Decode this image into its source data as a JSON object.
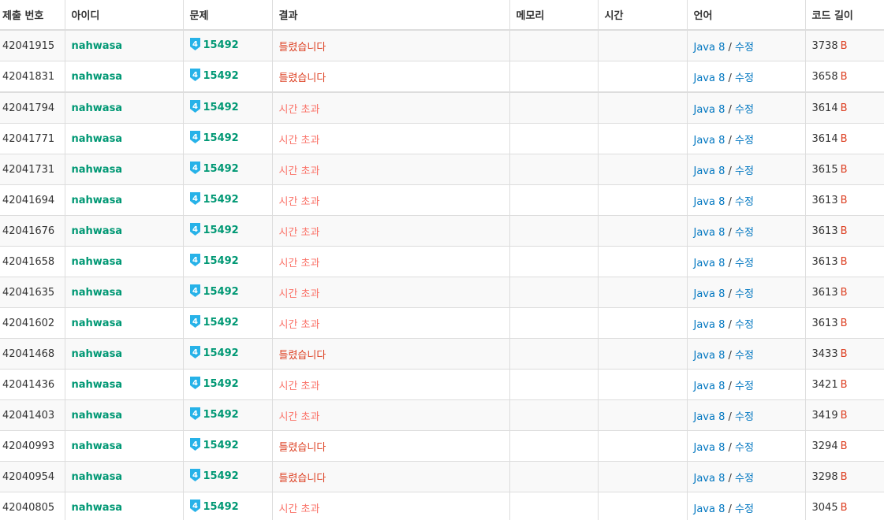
{
  "headers": {
    "id": "제출 번호",
    "user": "아이디",
    "problem": "문제",
    "result": "결과",
    "memory": "메모리",
    "time": "시간",
    "language": "언어",
    "code_length": "코드 길이"
  },
  "tier_icon": {
    "name": "silver-4-tier-icon",
    "label": "4",
    "color": "#27b2e8"
  },
  "edit_label": "수정",
  "slash": "/",
  "byte_unit": "B",
  "rows": [
    {
      "id": "42041915",
      "user": "nahwasa",
      "problem": "15492",
      "result": "틀렸습니다",
      "result_type": "wa",
      "memory": "",
      "time": "",
      "language": "Java 8",
      "length": "3738"
    },
    {
      "id": "42041831",
      "user": "nahwasa",
      "problem": "15492",
      "result": "틀렸습니다",
      "result_type": "wa",
      "memory": "",
      "time": "",
      "language": "Java 8",
      "length": "3658"
    },
    {
      "id": "42041794",
      "user": "nahwasa",
      "problem": "15492",
      "result": "시간 초과",
      "result_type": "tle",
      "memory": "",
      "time": "",
      "language": "Java 8",
      "length": "3614"
    },
    {
      "id": "42041771",
      "user": "nahwasa",
      "problem": "15492",
      "result": "시간 초과",
      "result_type": "tle",
      "memory": "",
      "time": "",
      "language": "Java 8",
      "length": "3614"
    },
    {
      "id": "42041731",
      "user": "nahwasa",
      "problem": "15492",
      "result": "시간 초과",
      "result_type": "tle",
      "memory": "",
      "time": "",
      "language": "Java 8",
      "length": "3615"
    },
    {
      "id": "42041694",
      "user": "nahwasa",
      "problem": "15492",
      "result": "시간 초과",
      "result_type": "tle",
      "memory": "",
      "time": "",
      "language": "Java 8",
      "length": "3613"
    },
    {
      "id": "42041676",
      "user": "nahwasa",
      "problem": "15492",
      "result": "시간 초과",
      "result_type": "tle",
      "memory": "",
      "time": "",
      "language": "Java 8",
      "length": "3613"
    },
    {
      "id": "42041658",
      "user": "nahwasa",
      "problem": "15492",
      "result": "시간 초과",
      "result_type": "tle",
      "memory": "",
      "time": "",
      "language": "Java 8",
      "length": "3613"
    },
    {
      "id": "42041635",
      "user": "nahwasa",
      "problem": "15492",
      "result": "시간 초과",
      "result_type": "tle",
      "memory": "",
      "time": "",
      "language": "Java 8",
      "length": "3613"
    },
    {
      "id": "42041602",
      "user": "nahwasa",
      "problem": "15492",
      "result": "시간 초과",
      "result_type": "tle",
      "memory": "",
      "time": "",
      "language": "Java 8",
      "length": "3613"
    },
    {
      "id": "42041468",
      "user": "nahwasa",
      "problem": "15492",
      "result": "틀렸습니다",
      "result_type": "wa",
      "memory": "",
      "time": "",
      "language": "Java 8",
      "length": "3433"
    },
    {
      "id": "42041436",
      "user": "nahwasa",
      "problem": "15492",
      "result": "시간 초과",
      "result_type": "tle",
      "memory": "",
      "time": "",
      "language": "Java 8",
      "length": "3421"
    },
    {
      "id": "42041403",
      "user": "nahwasa",
      "problem": "15492",
      "result": "시간 초과",
      "result_type": "tle",
      "memory": "",
      "time": "",
      "language": "Java 8",
      "length": "3419"
    },
    {
      "id": "42040993",
      "user": "nahwasa",
      "problem": "15492",
      "result": "틀렸습니다",
      "result_type": "wa",
      "memory": "",
      "time": "",
      "language": "Java 8",
      "length": "3294"
    },
    {
      "id": "42040954",
      "user": "nahwasa",
      "problem": "15492",
      "result": "틀렸습니다",
      "result_type": "wa",
      "memory": "",
      "time": "",
      "language": "Java 8",
      "length": "3298"
    },
    {
      "id": "42040805",
      "user": "nahwasa",
      "problem": "15492",
      "result": "시간 초과",
      "result_type": "tle",
      "memory": "",
      "time": "",
      "language": "Java 8",
      "length": "3045"
    }
  ]
}
